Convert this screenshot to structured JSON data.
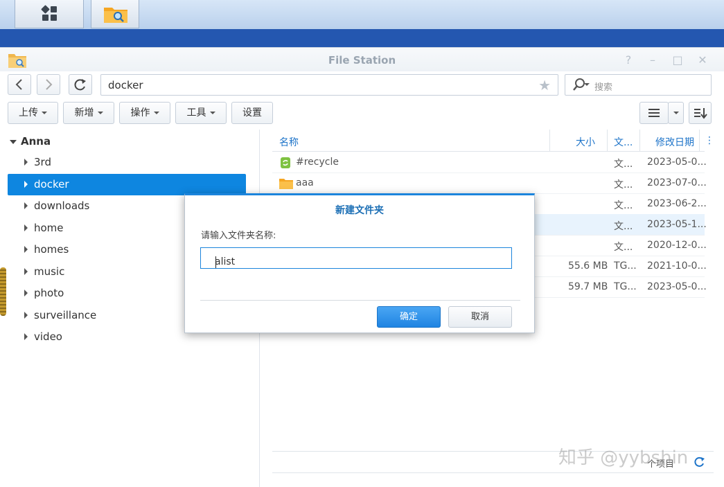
{
  "window": {
    "title": "File Station"
  },
  "path": {
    "value": "docker"
  },
  "search": {
    "placeholder": "搜索"
  },
  "toolbar": {
    "upload": "上传",
    "create": "新增",
    "action": "操作",
    "tools": "工具",
    "settings": "设置"
  },
  "tree": {
    "root": "Anna",
    "items": [
      {
        "label": "3rd"
      },
      {
        "label": "docker"
      },
      {
        "label": "downloads"
      },
      {
        "label": "home"
      },
      {
        "label": "homes"
      },
      {
        "label": "music"
      },
      {
        "label": "photo"
      },
      {
        "label": "surveillance"
      },
      {
        "label": "video"
      }
    ]
  },
  "grid": {
    "columns": {
      "name": "名称",
      "size": "大小",
      "type": "文...",
      "modified": "修改日期"
    },
    "rows": [
      {
        "name": "#recycle",
        "size": "",
        "type": "文...",
        "modified": "2023-05-0..."
      },
      {
        "name": "aaa",
        "size": "",
        "type": "文...",
        "modified": "2023-07-0..."
      },
      {
        "name": "",
        "size": "",
        "type": "文...",
        "modified": "2023-06-2..."
      },
      {
        "name": "",
        "size": "",
        "type": "文...",
        "modified": "2023-05-1..."
      },
      {
        "name": "",
        "size": "",
        "type": "文...",
        "modified": "2020-12-0..."
      },
      {
        "name": "",
        "size": "55.6 MB",
        "type": "TG...",
        "modified": "2021-10-0..."
      },
      {
        "name": "",
        "size": "59.7 MB",
        "type": "TG...",
        "modified": "2023-05-0..."
      }
    ],
    "footer": "个项目"
  },
  "dialog": {
    "title": "新建文件夹",
    "prompt": "请输入文件夹名称:",
    "value": "alist",
    "ok": "确定",
    "cancel": "取消"
  },
  "watermark": "知乎 @yybshin",
  "colors": {
    "accent": "#0e86e0",
    "desktop": "#2457b0"
  }
}
